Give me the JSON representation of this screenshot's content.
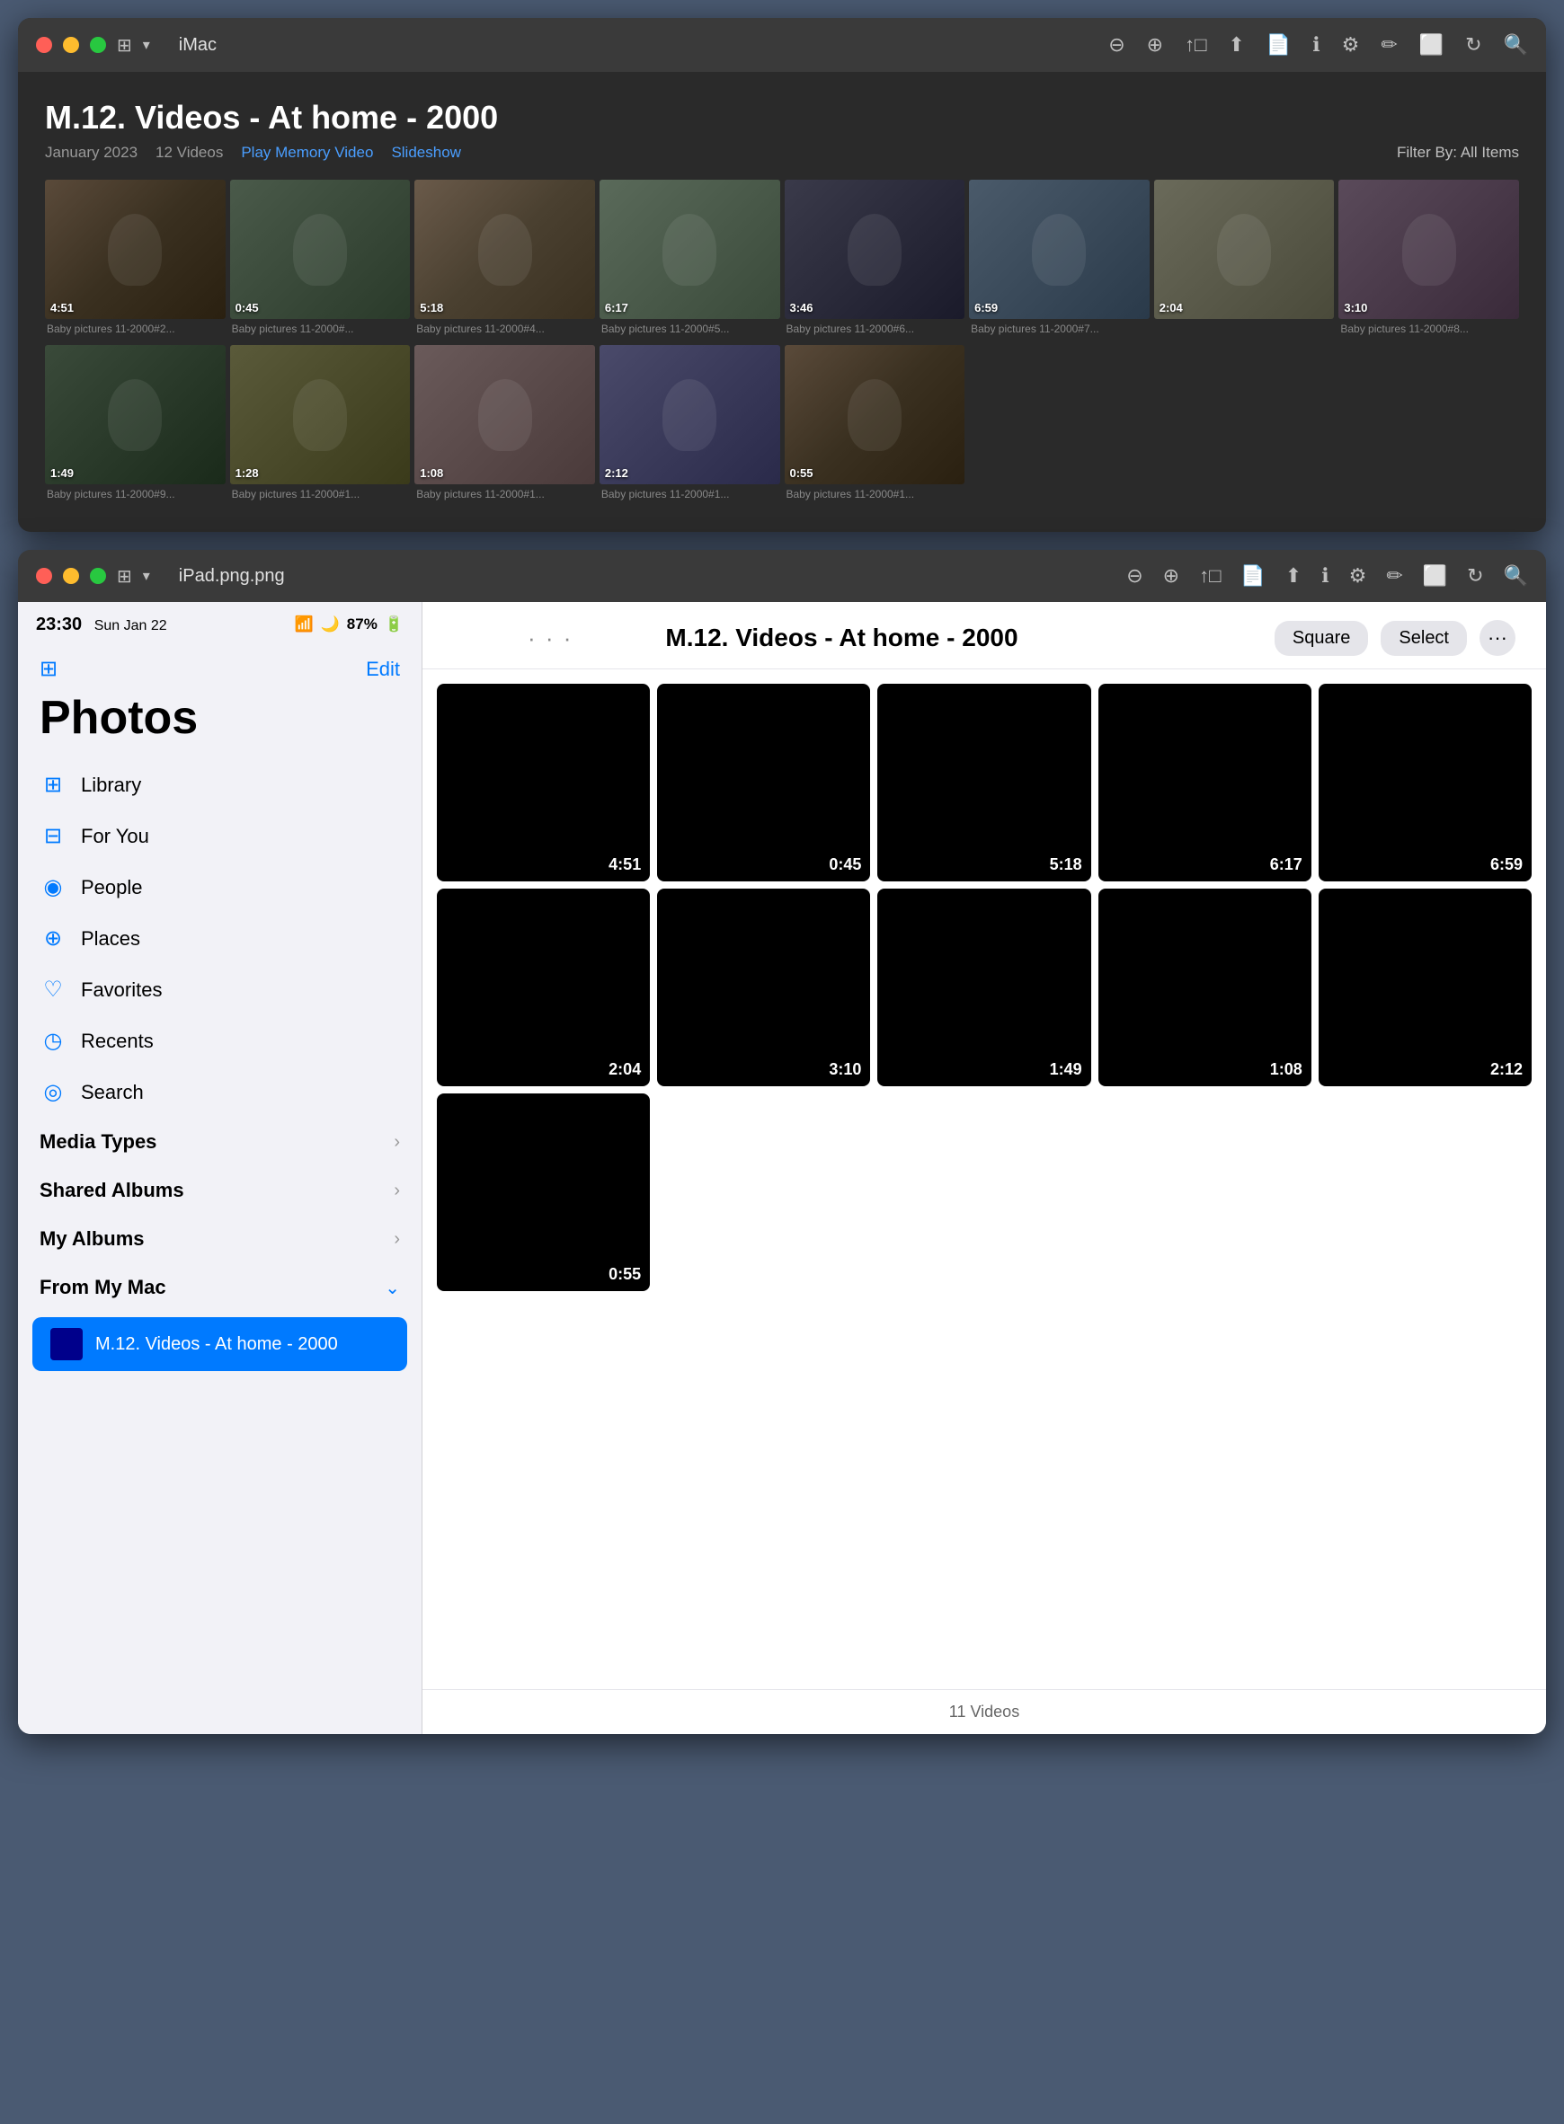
{
  "mac_window": {
    "title": "iMac",
    "album_title": "M.12. Videos - At home - 2000",
    "date": "January 2023",
    "count": "12 Videos",
    "play_memory": "Play Memory Video",
    "slideshow": "Slideshow",
    "filter": "Filter By: All Items",
    "thumbnails_row1": [
      {
        "label": "Baby pictures 11-2000#2...",
        "duration": "4:51",
        "bg": "baby-photo-1"
      },
      {
        "label": "Baby pictures 11-2000#...",
        "duration": "0:45",
        "bg": "baby-photo-2"
      },
      {
        "label": "Baby pictures 11-2000#4...",
        "duration": "5:18",
        "bg": "baby-photo-3"
      },
      {
        "label": "Baby pictures 11-2000#5...",
        "duration": "6:17",
        "bg": "baby-photo-4"
      },
      {
        "label": "Baby pictures 11-2000#6...",
        "duration": "3:46",
        "bg": "baby-photo-5"
      },
      {
        "label": "Baby pictures 11-2000#7...",
        "duration": "6:59",
        "bg": "baby-photo-6"
      },
      {
        "label": "",
        "duration": "2:04",
        "bg": "baby-photo-7"
      },
      {
        "label": "Baby pictures 11-2000#8...",
        "duration": "3:10",
        "bg": "baby-photo-8"
      }
    ],
    "thumbnails_row2": [
      {
        "label": "Baby pictures 11-2000#9...",
        "duration": "1:49",
        "bg": "baby-photo-9"
      },
      {
        "label": "Baby pictures 11-2000#1...",
        "duration": "1:28",
        "bg": "baby-photo-10"
      },
      {
        "label": "Baby pictures 11-2000#1...",
        "duration": "1:08",
        "bg": "baby-photo-11"
      },
      {
        "label": "Baby pictures 11-2000#1...",
        "duration": "2:12",
        "bg": "baby-photo-12"
      },
      {
        "label": "Baby pictures 11-2000#1...",
        "duration": "0:55",
        "bg": "baby-photo-1"
      }
    ]
  },
  "ipad_window": {
    "title": "iPad.png.png",
    "status_time": "23:30",
    "status_date": "Sun Jan 22",
    "battery": "87%",
    "sidebar": {
      "photos_title": "Photos",
      "edit_label": "Edit",
      "nav_items": [
        {
          "id": "library",
          "label": "Library",
          "icon": "⊞"
        },
        {
          "id": "for-you",
          "label": "For You",
          "icon": "⊟"
        },
        {
          "id": "people",
          "label": "People",
          "icon": "◉"
        },
        {
          "id": "places",
          "label": "Places",
          "icon": "⊕"
        },
        {
          "id": "favorites",
          "label": "Favorites",
          "icon": "♡"
        },
        {
          "id": "recents",
          "label": "Recents",
          "icon": "◷"
        },
        {
          "id": "search",
          "label": "Search",
          "icon": "◎"
        }
      ],
      "sections": [
        {
          "id": "media-types",
          "label": "Media Types",
          "expanded": false
        },
        {
          "id": "shared-albums",
          "label": "Shared Albums",
          "expanded": false
        },
        {
          "id": "my-albums",
          "label": "My Albums",
          "expanded": false
        },
        {
          "id": "from-my-mac",
          "label": "From My Mac",
          "expanded": true
        }
      ],
      "selected_item_label": "M.12. Videos - At home - 2000"
    },
    "main": {
      "album_title": "M.12. Videos - At home - 2000",
      "square_btn": "Square",
      "select_btn": "Select",
      "more_btn": "···",
      "videos_footer": "11 Videos",
      "video_rows": [
        [
          {
            "duration": "4:51"
          },
          {
            "duration": "0:45"
          },
          {
            "duration": "5:18"
          },
          {
            "duration": "6:17"
          },
          {
            "duration": "6:59"
          }
        ],
        [
          {
            "duration": "2:04"
          },
          {
            "duration": "3:10"
          },
          {
            "duration": "1:49"
          },
          {
            "duration": "1:08"
          },
          {
            "duration": "2:12"
          }
        ],
        [
          {
            "duration": "0:55"
          }
        ]
      ]
    }
  }
}
